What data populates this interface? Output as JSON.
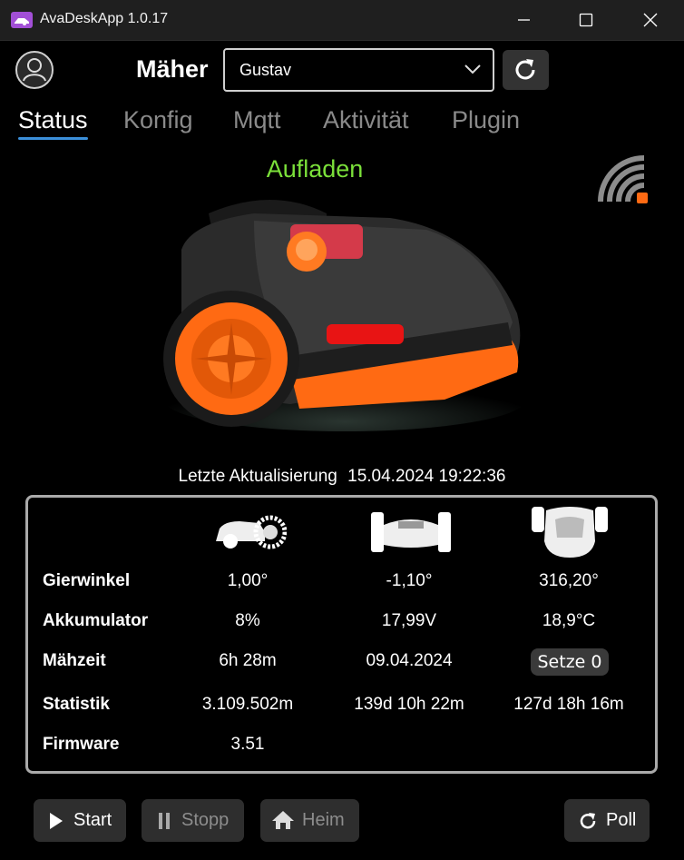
{
  "window": {
    "title": "AvaDeskApp 1.0.17"
  },
  "header": {
    "mower_label": "Mäher",
    "mower_selected": "Gustav"
  },
  "tabs": [
    "Status",
    "Konfig",
    "Mqtt",
    "Aktivität",
    "Plugin"
  ],
  "status": {
    "state_text": "Aufladen",
    "state_color": "#7be03a"
  },
  "last_update": {
    "label": "Letzte Aktualisierung",
    "value": "15.04.2024 19:22:36"
  },
  "stats": {
    "rows": [
      {
        "label": "Gierwinkel",
        "values": [
          "1,00°",
          "-1,10°",
          "316,20°"
        ]
      },
      {
        "label": "Akkumulator",
        "values": [
          "8%",
          "17,99V",
          "18,9°C"
        ]
      },
      {
        "label": "Mähzeit",
        "values": [
          "6h 28m",
          "09.04.2024"
        ],
        "button": "Setze 0"
      },
      {
        "label": "Statistik",
        "values": [
          "3.109.502m",
          "139d 10h 22m",
          "127d 18h 16m"
        ]
      },
      {
        "label": "Firmware",
        "values": [
          "3.51"
        ]
      }
    ],
    "icons": [
      "mower-side-icon",
      "mower-front-icon",
      "mower-top-icon"
    ]
  },
  "actions": {
    "start": "Start",
    "stop": "Stopp",
    "home": "Heim",
    "poll": "Poll"
  },
  "colors": {
    "accent": "#3b8fd9",
    "orange": "#ff6a13",
    "wifi_dot": "#ff6a13"
  }
}
